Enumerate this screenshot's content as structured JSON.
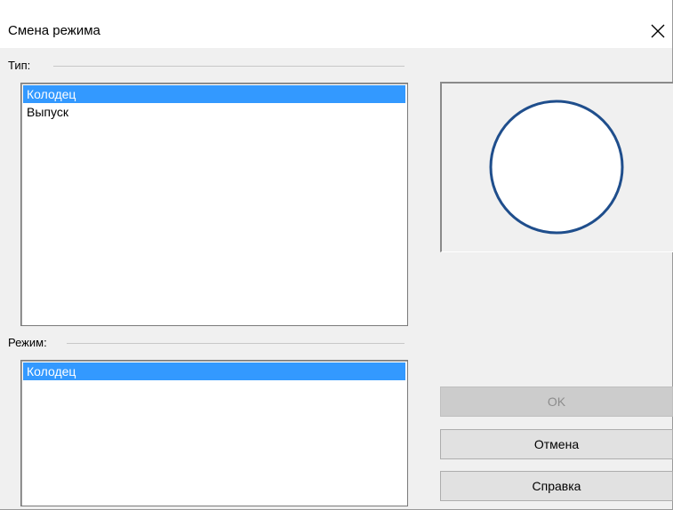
{
  "window": {
    "title": "Смена режима"
  },
  "type_group": {
    "label": "Тип:",
    "items": [
      {
        "label": "Колодец",
        "selected": true
      },
      {
        "label": "Выпуск",
        "selected": false
      }
    ]
  },
  "mode_group": {
    "label": "Режим:",
    "items": [
      {
        "label": "Колодец",
        "selected": true
      }
    ]
  },
  "preview": {
    "shape": "circle",
    "stroke_color": "#1f4e8c",
    "fill_color": "#ffffff"
  },
  "buttons": {
    "ok": {
      "label": "OK",
      "enabled": false
    },
    "cancel": {
      "label": "Отмена",
      "enabled": true
    },
    "help": {
      "label": "Справка",
      "enabled": true
    }
  },
  "colors": {
    "selection": "#3399ff",
    "dialog_bg": "#f0f0f0"
  }
}
